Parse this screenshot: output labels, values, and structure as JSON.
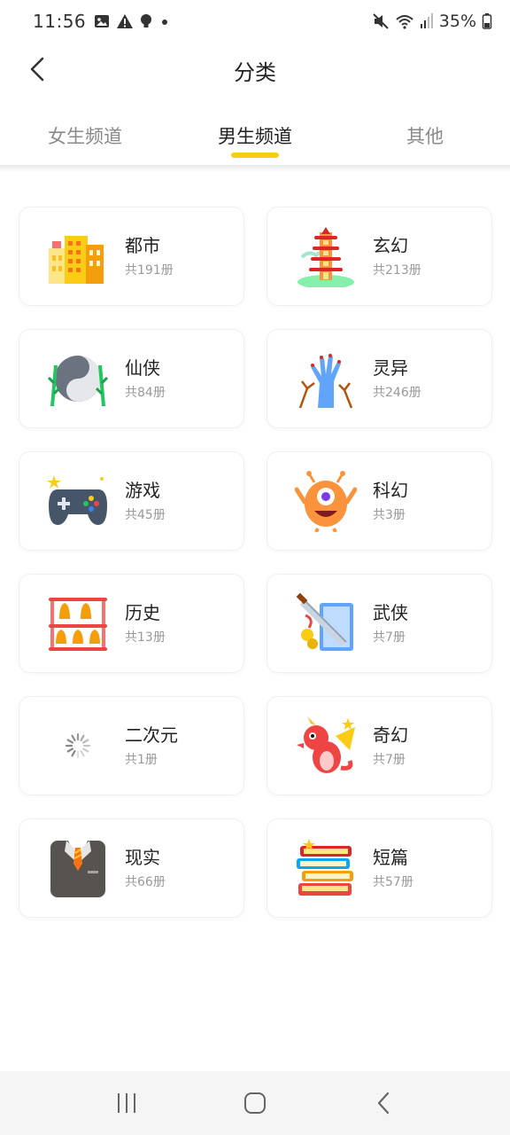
{
  "status_bar": {
    "time": "11:56",
    "battery": "35%",
    "left_icons": [
      "image-icon",
      "warning-icon",
      "bulb-icon",
      "dot-icon"
    ],
    "right_icons": [
      "mute-icon",
      "wifi-icon",
      "signal-icon",
      "battery-icon"
    ]
  },
  "header": {
    "title": "分类",
    "back_icon": "chevron-left-icon"
  },
  "tabs": [
    {
      "label": "女生频道",
      "active": false
    },
    {
      "label": "男生频道",
      "active": true
    },
    {
      "label": "其他",
      "active": false
    }
  ],
  "categories": [
    {
      "name": "都市",
      "count": "共191册",
      "icon": "city-buildings-icon"
    },
    {
      "name": "玄幻",
      "count": "共213册",
      "icon": "pagoda-icon"
    },
    {
      "name": "仙侠",
      "count": "共84册",
      "icon": "yin-yang-icon"
    },
    {
      "name": "灵异",
      "count": "共246册",
      "icon": "zombie-hand-icon"
    },
    {
      "name": "游戏",
      "count": "共45册",
      "icon": "gamepad-icon"
    },
    {
      "name": "科幻",
      "count": "共3册",
      "icon": "alien-monster-icon"
    },
    {
      "name": "历史",
      "count": "共13册",
      "icon": "chime-bells-icon"
    },
    {
      "name": "武侠",
      "count": "共7册",
      "icon": "sword-book-icon"
    },
    {
      "name": "二次元",
      "count": "共1册",
      "icon": "loading-spinner-icon"
    },
    {
      "name": "奇幻",
      "count": "共7册",
      "icon": "dragon-icon"
    },
    {
      "name": "现实",
      "count": "共66册",
      "icon": "suit-icon"
    },
    {
      "name": "短篇",
      "count": "共57册",
      "icon": "book-stack-icon"
    }
  ],
  "nav_bar": {
    "buttons": [
      "recent-apps-icon",
      "home-icon",
      "back-icon"
    ]
  },
  "colors": {
    "accent": "#f6cf12",
    "text": "#222222",
    "muted": "#999999"
  }
}
